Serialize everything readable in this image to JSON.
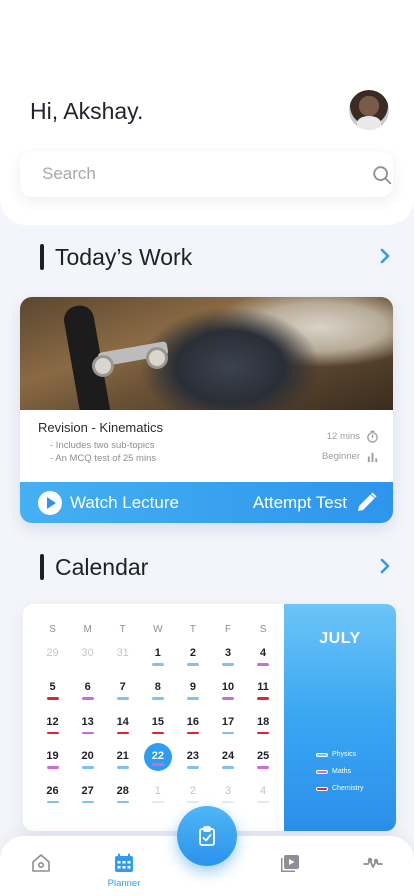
{
  "header": {
    "greeting": "Hi, Akshay.",
    "avatar_icon": "user-avatar"
  },
  "search": {
    "placeholder": "Search",
    "value": ""
  },
  "todays_work": {
    "title": "Today’s Work",
    "card": {
      "title": "Revision - Kinematics",
      "details": [
        "- Includes two sub-topics",
        "- An MCQ test of 25 mins"
      ],
      "duration": "12 mins",
      "level": "Beginner",
      "watch_label": "Watch Lecture",
      "attempt_label": "Attempt Test"
    }
  },
  "calendar": {
    "title": "Calendar",
    "month": "JULY",
    "weekdays": [
      "S",
      "M",
      "T",
      "W",
      "T",
      "F",
      "S"
    ],
    "weeks": [
      [
        {
          "d": "29",
          "muted": true
        },
        {
          "d": "30",
          "muted": true
        },
        {
          "d": "31",
          "muted": true
        },
        {
          "d": "1",
          "mark": "physics"
        },
        {
          "d": "2",
          "mark": "physics"
        },
        {
          "d": "3",
          "mark": "physics"
        },
        {
          "d": "4",
          "mark": "maths"
        }
      ],
      [
        {
          "d": "5",
          "mark": "chemistry"
        },
        {
          "d": "6",
          "mark": "maths"
        },
        {
          "d": "7",
          "mark": "physics"
        },
        {
          "d": "8",
          "mark": "physics"
        },
        {
          "d": "9",
          "mark": "physics"
        },
        {
          "d": "10",
          "mark": "maths"
        },
        {
          "d": "11",
          "mark": "chemistry"
        }
      ],
      [
        {
          "d": "12",
          "mark": "chemistry"
        },
        {
          "d": "13",
          "mark": "maths"
        },
        {
          "d": "14",
          "mark": "chemistry"
        },
        {
          "d": "15",
          "mark": "chemistry"
        },
        {
          "d": "16",
          "mark": "chemistry"
        },
        {
          "d": "17",
          "mark": "physics"
        },
        {
          "d": "18",
          "mark": "chemistry"
        }
      ],
      [
        {
          "d": "19",
          "mark": "maths"
        },
        {
          "d": "20",
          "mark": "physics"
        },
        {
          "d": "21",
          "mark": "physics"
        },
        {
          "d": "22",
          "mark": "maths",
          "selected": true
        },
        {
          "d": "23",
          "mark": "physics"
        },
        {
          "d": "24",
          "mark": "physics"
        },
        {
          "d": "25",
          "mark": "maths"
        }
      ],
      [
        {
          "d": "26",
          "mark": "physics"
        },
        {
          "d": "27",
          "mark": "physics"
        },
        {
          "d": "28",
          "mark": "physics"
        },
        {
          "d": "1",
          "muted": true,
          "mark": "faint"
        },
        {
          "d": "2",
          "muted": true,
          "mark": "faint"
        },
        {
          "d": "3",
          "muted": true,
          "mark": "faint"
        },
        {
          "d": "4",
          "muted": true,
          "mark": "faint"
        }
      ]
    ],
    "legend": [
      {
        "key": "physics",
        "label": "Physics"
      },
      {
        "key": "maths",
        "label": "Maths"
      },
      {
        "key": "chemistry",
        "label": "Chemistry"
      }
    ],
    "colors": {
      "physics": "#7cc3f3",
      "maths": "#c96ddc",
      "chemistry": "#e0252f",
      "faint": "#dfe9f5"
    }
  },
  "nav": {
    "items": [
      {
        "key": "home",
        "icon": "home-icon"
      },
      {
        "key": "planner",
        "icon": "calendar-icon",
        "label": "Planner",
        "active": true
      },
      {
        "key": "videos",
        "icon": "video-library-icon"
      },
      {
        "key": "activity",
        "icon": "activity-wave-icon"
      }
    ],
    "fab_icon": "clipboard-check-icon"
  },
  "theme": {
    "accent": "#2f9cf0",
    "text_dark": "#1f1f2a",
    "background": "#f3f5fa"
  }
}
